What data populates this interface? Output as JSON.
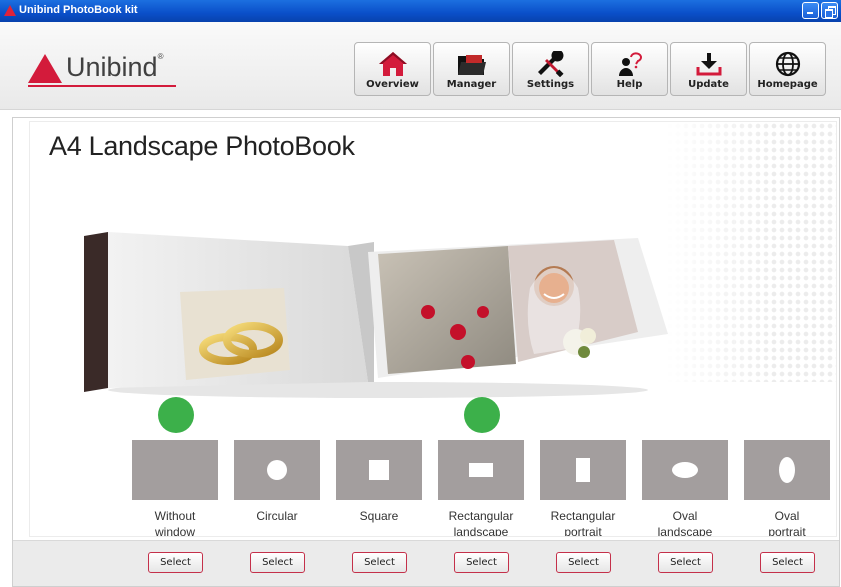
{
  "window": {
    "title": "Unibind PhotoBook kit",
    "accent_color": "#0a4fc9"
  },
  "header": {
    "logo_text": "Unibind",
    "logo_mark": "®",
    "brand_color": "#d31b3b",
    "nav": [
      {
        "label": "Overview",
        "icon": "home-icon"
      },
      {
        "label": "Manager",
        "icon": "folder-icon"
      },
      {
        "label": "Settings",
        "icon": "wrench-icon"
      },
      {
        "label": "Help",
        "icon": "help-person-icon"
      },
      {
        "label": "Update",
        "icon": "download-icon"
      },
      {
        "label": "Homepage",
        "icon": "globe-icon"
      }
    ]
  },
  "main": {
    "title": "A4 Landscape PhotoBook",
    "selected_color": "#3cb04a",
    "options": [
      {
        "label": "Without\nwindow",
        "selected": true,
        "button": "Select"
      },
      {
        "label": "Circular",
        "selected": false,
        "button": "Select"
      },
      {
        "label": "Square",
        "selected": false,
        "button": "Select"
      },
      {
        "label": "Rectangular\nlandscape",
        "selected": true,
        "button": "Select"
      },
      {
        "label": "Rectangular\nportrait",
        "selected": false,
        "button": "Select"
      },
      {
        "label": "Oval\nlandscape",
        "selected": false,
        "button": "Select"
      },
      {
        "label": "Oval\nportrait",
        "selected": false,
        "button": "Select"
      }
    ]
  }
}
